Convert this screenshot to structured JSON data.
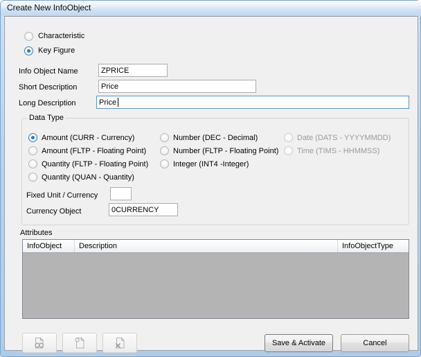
{
  "window": {
    "title": "Create New InfoObject"
  },
  "object_type": {
    "options": [
      {
        "label": "Characteristic",
        "selected": false
      },
      {
        "label": "Key Figure",
        "selected": true
      }
    ]
  },
  "fields": [
    {
      "label": "Info Object Name",
      "value": "ZPRICE",
      "placeholder": "",
      "focused": false
    },
    {
      "label": "Short Description",
      "value": "Price",
      "placeholder": "",
      "focused": false
    },
    {
      "label": "Long Description",
      "value": "Price",
      "placeholder": "",
      "focused": true
    }
  ],
  "data_type": {
    "title": "Data Type",
    "column1": [
      {
        "label": "Amount (CURR - Currency)",
        "selected": true,
        "disabled": false
      },
      {
        "label": "Amount (FLTP - Floating Point)",
        "selected": false,
        "disabled": false
      },
      {
        "label": "Quantity (FLTP - Floating Point)",
        "selected": false,
        "disabled": false
      },
      {
        "label": "Quantity (QUAN - Quantity)",
        "selected": false,
        "disabled": false
      }
    ],
    "column2": [
      {
        "label": "Number (DEC - Decimal)",
        "selected": false,
        "disabled": false
      },
      {
        "label": "Number (FLTP - Floating Point)",
        "selected": false,
        "disabled": false
      },
      {
        "label": "Integer (INT4 -Integer)",
        "selected": false,
        "disabled": false
      }
    ],
    "column3": [
      {
        "label": "Date (DATS - YYYYMMDD)",
        "selected": false,
        "disabled": true
      },
      {
        "label": "Time (TIMS - HHMMSS)",
        "selected": false,
        "disabled": true
      }
    ],
    "unit_fields": [
      {
        "label": "Fixed Unit / Currency",
        "value": "",
        "placeholder": ""
      },
      {
        "label": "Currency Object",
        "value": "0CURRENCY",
        "placeholder": ""
      }
    ]
  },
  "attributes": {
    "title": "Attributes",
    "columns": [
      "InfoObject",
      "Description",
      "InfoObjectType"
    ],
    "rows": []
  },
  "toolbar": {
    "buttons": [
      {
        "icon": "page-view-icon",
        "disabled": true
      },
      {
        "icon": "page-new-icon",
        "disabled": true
      },
      {
        "icon": "page-delete-icon",
        "disabled": true
      }
    ]
  },
  "actions": {
    "save": "Save & Activate",
    "cancel": "Cancel"
  }
}
